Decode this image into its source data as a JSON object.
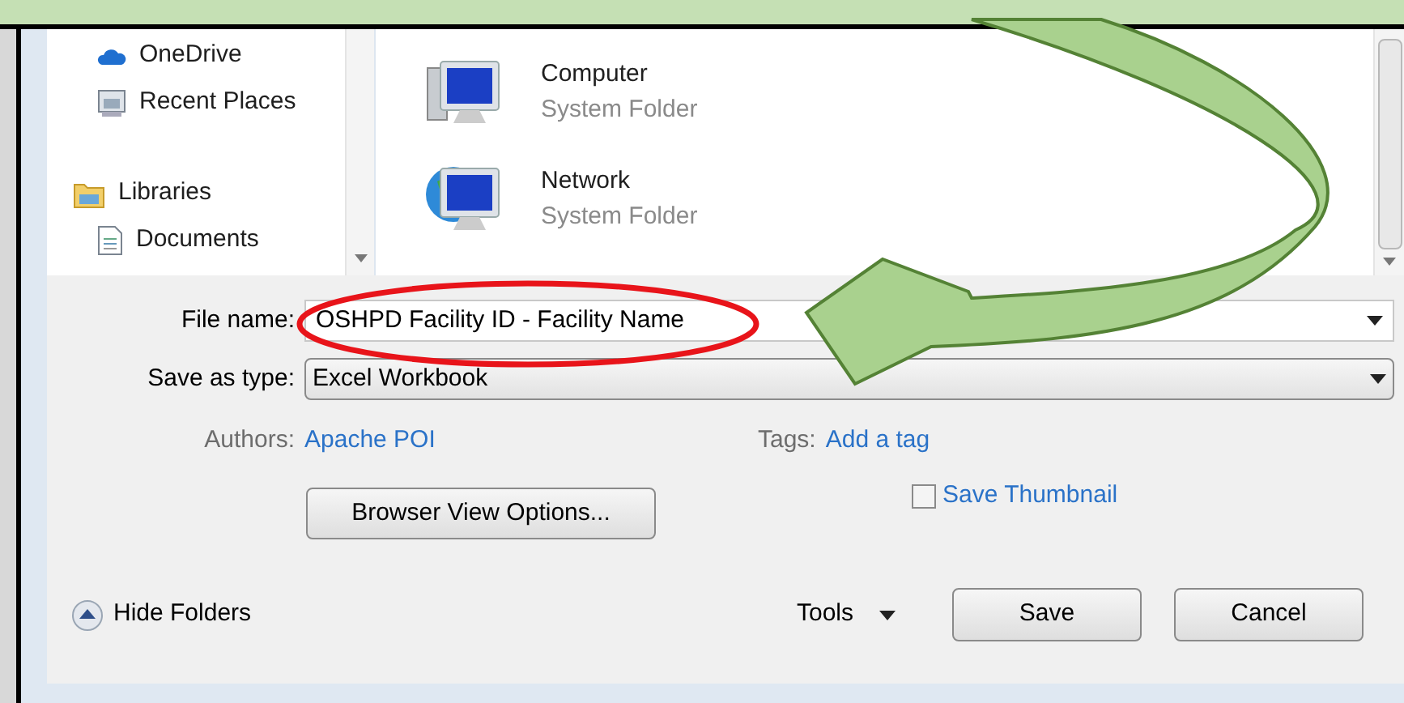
{
  "sidebar": {
    "items": [
      {
        "label": "OneDrive",
        "kind": "cloud"
      },
      {
        "label": "Recent Places",
        "kind": "recent"
      },
      {
        "label": "Libraries",
        "kind": "library",
        "children": [
          {
            "label": "Documents",
            "kind": "document"
          }
        ]
      }
    ]
  },
  "files": [
    {
      "name": "Computer",
      "type": "System Folder",
      "kind": "computer"
    },
    {
      "name": "Network",
      "type": "System Folder",
      "kind": "network"
    }
  ],
  "form": {
    "file_name": {
      "label": "File name:",
      "value": "OSHPD Facility ID - Facility Name"
    },
    "save_as_type": {
      "label": "Save as type:",
      "value": "Excel Workbook"
    },
    "authors": {
      "label": "Authors:",
      "value": "Apache POI"
    },
    "tags": {
      "label": "Tags:",
      "value": "Add a tag"
    },
    "browser_view_options": "Browser View Options...",
    "save_thumbnail": {
      "label": "Save Thumbnail",
      "checked": false
    }
  },
  "footer": {
    "hide_folders": "Hide Folders",
    "tools": "Tools",
    "buttons": [
      "Save",
      "Cancel"
    ]
  }
}
